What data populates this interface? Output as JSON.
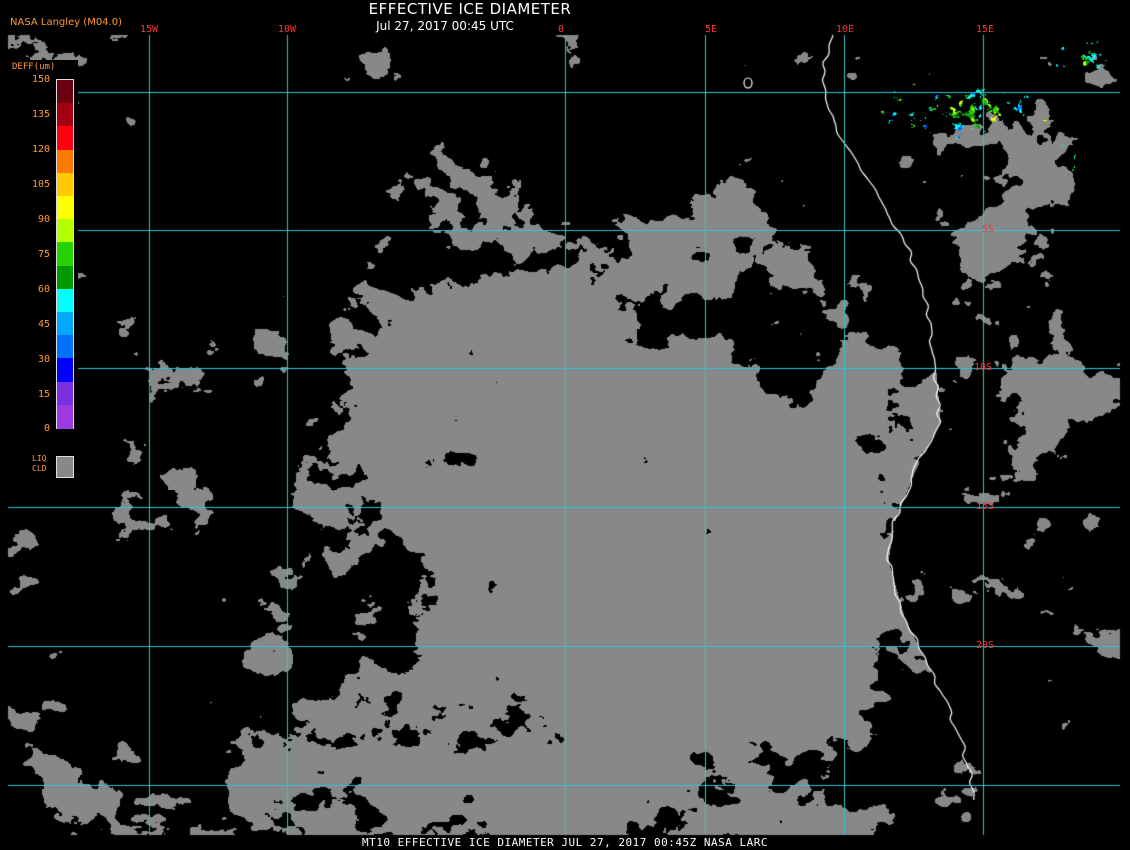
{
  "title": "EFFECTIVE ICE DIAMETER",
  "subtitle": "Jul 27, 2017 00:45 UTC",
  "producer": "NASA Langley (M04.0)",
  "footer": "MT10  EFFECTIVE ICE DIAMETER  JUL 27, 2017 00:45Z  NASA LARC",
  "colors": {
    "background": "#000000",
    "cloud": "#888888",
    "grid": "#28c8d8",
    "coast": "#ffffff",
    "label": "#ff3333",
    "legend_text": "#ff9933"
  },
  "grid": {
    "lon": [
      {
        "label": "15W",
        "value": -15
      },
      {
        "label": "10W",
        "value": -10
      },
      {
        "label": "0",
        "value": 0
      },
      {
        "label": "5E",
        "value": 5
      },
      {
        "label": "10E",
        "value": 10
      },
      {
        "label": "15E",
        "value": 15
      }
    ],
    "lat": [
      {
        "label": "5S",
        "value": -5
      },
      {
        "label": "10S",
        "value": -10
      },
      {
        "label": "15S",
        "value": -15
      },
      {
        "label": "20S",
        "value": -20
      }
    ]
  },
  "legend": {
    "title": "DEFF(um)",
    "ticks": [
      "150",
      "135",
      "120",
      "105",
      "90",
      "75",
      "60",
      "45",
      "30",
      "15",
      "0"
    ],
    "colors": [
      "#6a0012",
      "#a30012",
      "#ff0010",
      "#ff7a00",
      "#ffc800",
      "#ffff00",
      "#b4ff00",
      "#28d200",
      "#009a00",
      "#00ffff",
      "#00a8ff",
      "#0070ff",
      "#0000ff",
      "#7a30e0",
      "#9a3ae0"
    ],
    "liquid_label_1": "LIQ",
    "liquid_label_2": "CLD"
  }
}
